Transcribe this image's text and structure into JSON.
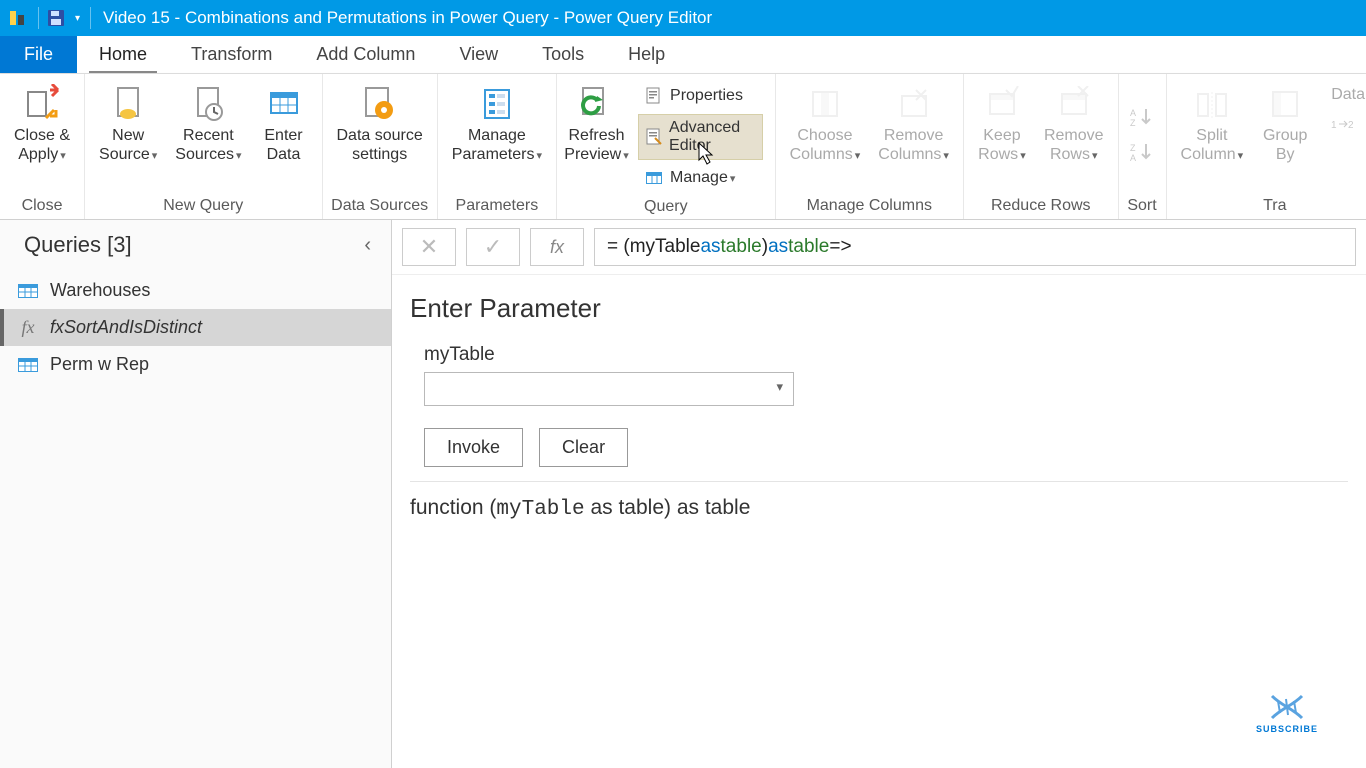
{
  "titlebar": {
    "title": "Video 15 - Combinations and Permutations in Power Query - Power Query Editor"
  },
  "tabs": {
    "file": "File",
    "home": "Home",
    "transform": "Transform",
    "addcolumn": "Add Column",
    "view": "View",
    "tools": "Tools",
    "help": "Help"
  },
  "ribbon": {
    "close": {
      "closeapply": "Close &\nApply",
      "group": "Close"
    },
    "newquery": {
      "newsource": "New\nSource",
      "recent": "Recent\nSources",
      "enter": "Enter\nData",
      "group": "New Query"
    },
    "datasources": {
      "dss": "Data source\nsettings",
      "group": "Data Sources"
    },
    "parameters": {
      "manage": "Manage\nParameters",
      "group": "Parameters"
    },
    "query": {
      "refresh": "Refresh\nPreview",
      "properties": "Properties",
      "advanced": "Advanced Editor",
      "manage": "Manage",
      "group": "Query"
    },
    "managecols": {
      "choose": "Choose\nColumns",
      "remove": "Remove\nColumns",
      "group": "Manage Columns"
    },
    "reducerows": {
      "keep": "Keep\nRows",
      "remove": "Remove\nRows",
      "group": "Reduce Rows"
    },
    "sort": {
      "group": "Sort"
    },
    "transform": {
      "split": "Split\nColumn",
      "group": "Group\nBy",
      "datatype": "Data",
      "grouplabel": "Tra"
    }
  },
  "side": {
    "title": "Queries [3]",
    "items": [
      {
        "label": "Warehouses",
        "type": "table"
      },
      {
        "label": "fxSortAndIsDistinct",
        "type": "fx"
      },
      {
        "label": "Perm w Rep",
        "type": "table"
      }
    ]
  },
  "formula": {
    "eq": "= (",
    "p1": "myTable ",
    "as1": "as ",
    "t1": "table",
    "close1": ") ",
    "as2": "as ",
    "t2": "table",
    "arrow": " =>"
  },
  "param": {
    "heading": "Enter Parameter",
    "label": "myTable",
    "invoke": "Invoke",
    "clear": "Clear"
  },
  "signature": {
    "prefix": "function (",
    "p": "myTable",
    "rest": " as table) as table"
  },
  "watermark": "SUBSCRIBE"
}
